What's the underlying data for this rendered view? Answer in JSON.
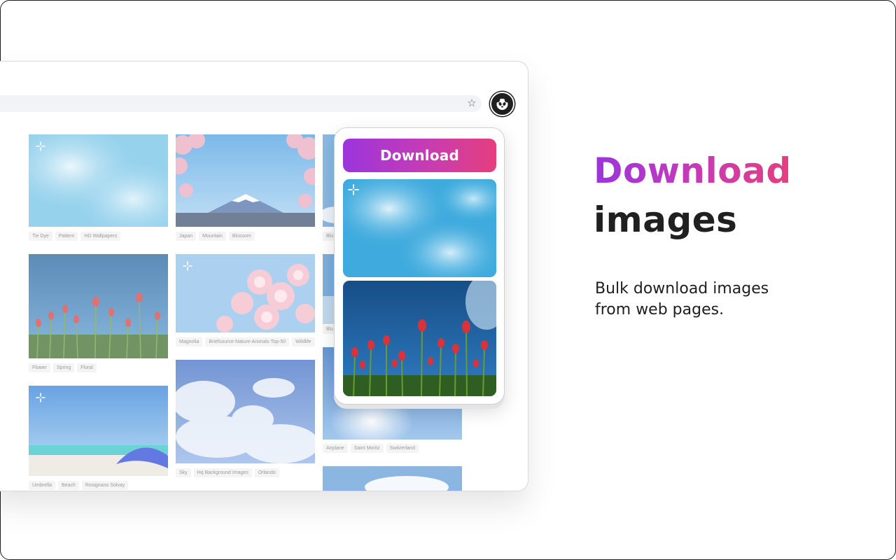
{
  "browser": {
    "address_bar_value": "",
    "star_icon": "star-icon",
    "extension_icon": "panda-icon"
  },
  "gallery": {
    "columns": [
      {
        "tiles": [
          {
            "name": "tie-dye",
            "tags": [
              "Tie Dye",
              "Pattern",
              "HD Wallpapers"
            ]
          },
          {
            "name": "flower",
            "tags": [
              "Flower",
              "Spring",
              "Floral"
            ]
          },
          {
            "name": "umbrella",
            "tags": [
              "Umbrella",
              "Beach",
              "Rosignano Solvay"
            ]
          }
        ]
      },
      {
        "tiles": [
          {
            "name": "japan",
            "tags": [
              "Japan",
              "Mountain",
              "Blossom"
            ]
          },
          {
            "name": "magnolia",
            "tags": [
              "Magnolia",
              "Briefsource-Nature-Animals-Top-50",
              "Wildlife"
            ]
          },
          {
            "name": "sky",
            "tags": [
              "Sky",
              "Hq Background Images",
              "Orlando"
            ]
          }
        ]
      },
      {
        "tiles": [
          {
            "name": "blue-1",
            "tags": [
              "Blu"
            ]
          },
          {
            "name": "blue-2",
            "tags": [
              "Blu"
            ]
          },
          {
            "name": "airplane",
            "tags": [
              "Airplane",
              "Saint Moritz",
              "Switzerland"
            ]
          }
        ]
      }
    ]
  },
  "popup": {
    "download_label": "Download"
  },
  "hero": {
    "title_line1": "Download",
    "title_line2": "images",
    "subtitle_line1": "Bulk download images",
    "subtitle_line2": "from web pages."
  },
  "colors": {
    "gradient_start": "#9b34dd",
    "gradient_mid": "#c43bb7",
    "gradient_end": "#e43f7e",
    "text_dark": "#202020"
  }
}
